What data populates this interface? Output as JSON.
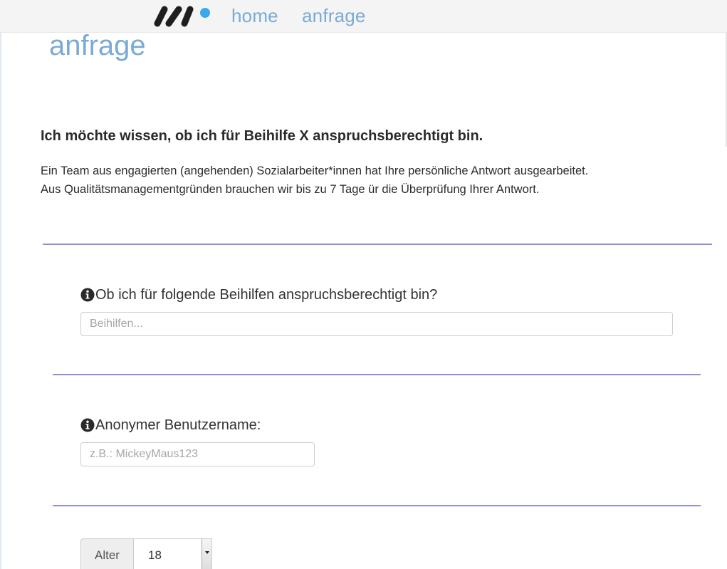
{
  "nav": {
    "logo_icon": "brand-logo",
    "links": [
      {
        "label": "home"
      },
      {
        "label": "anfrage"
      }
    ]
  },
  "page": {
    "title": "anfrage"
  },
  "intro": {
    "heading": "Ich möchte wissen, ob ich für Beihilfe X anspruchsberechtigt bin.",
    "line1": "Ein Team aus engagierten (angehenden) Sozialarbeiter*innen hat Ihre persönliche Antwort ausgearbeitet.",
    "line2": "Aus Qualitätsmanagementgründen brauchen wir bis zu 7 Tage ür die Überprüfung Ihrer Antwort."
  },
  "form": {
    "beihilfen": {
      "label": "Ob ich für folgende Beihilfen anspruchsberechtigt bin?",
      "placeholder": "Beihilfen...",
      "value": ""
    },
    "username": {
      "label": "Anonymer Benutzername:",
      "placeholder": "z.B.: MickeyMaus123",
      "value": ""
    },
    "age": {
      "label": "Alter",
      "selected": "18"
    }
  },
  "colors": {
    "accent": "#7aaad6",
    "divider": "#8e8ed6",
    "logo_dot": "#3aa9ea"
  },
  "icons": {
    "info": "info-circle-icon"
  }
}
